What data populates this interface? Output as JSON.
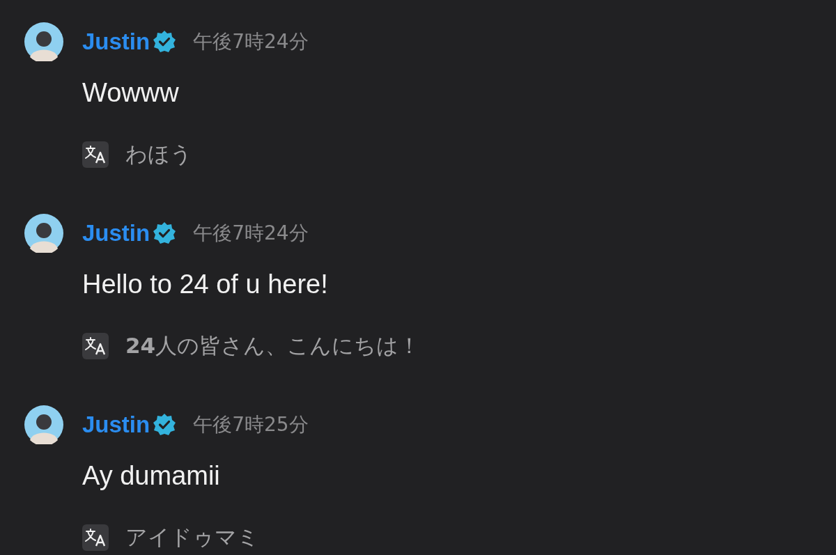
{
  "messages": [
    {
      "author": "Justin",
      "verified": true,
      "time": "午後7時24分",
      "text": "Wowww",
      "translation": "わほう"
    },
    {
      "author": "Justin",
      "verified": true,
      "time": "午後7時24分",
      "text": "Hello to 24 of u here!",
      "translation": "**24**人の皆さん、こんにちは！"
    },
    {
      "author": "Justin",
      "verified": true,
      "time": "午後7時25分",
      "text": "Ay dumamii",
      "translation": "アイドゥマミ"
    }
  ]
}
